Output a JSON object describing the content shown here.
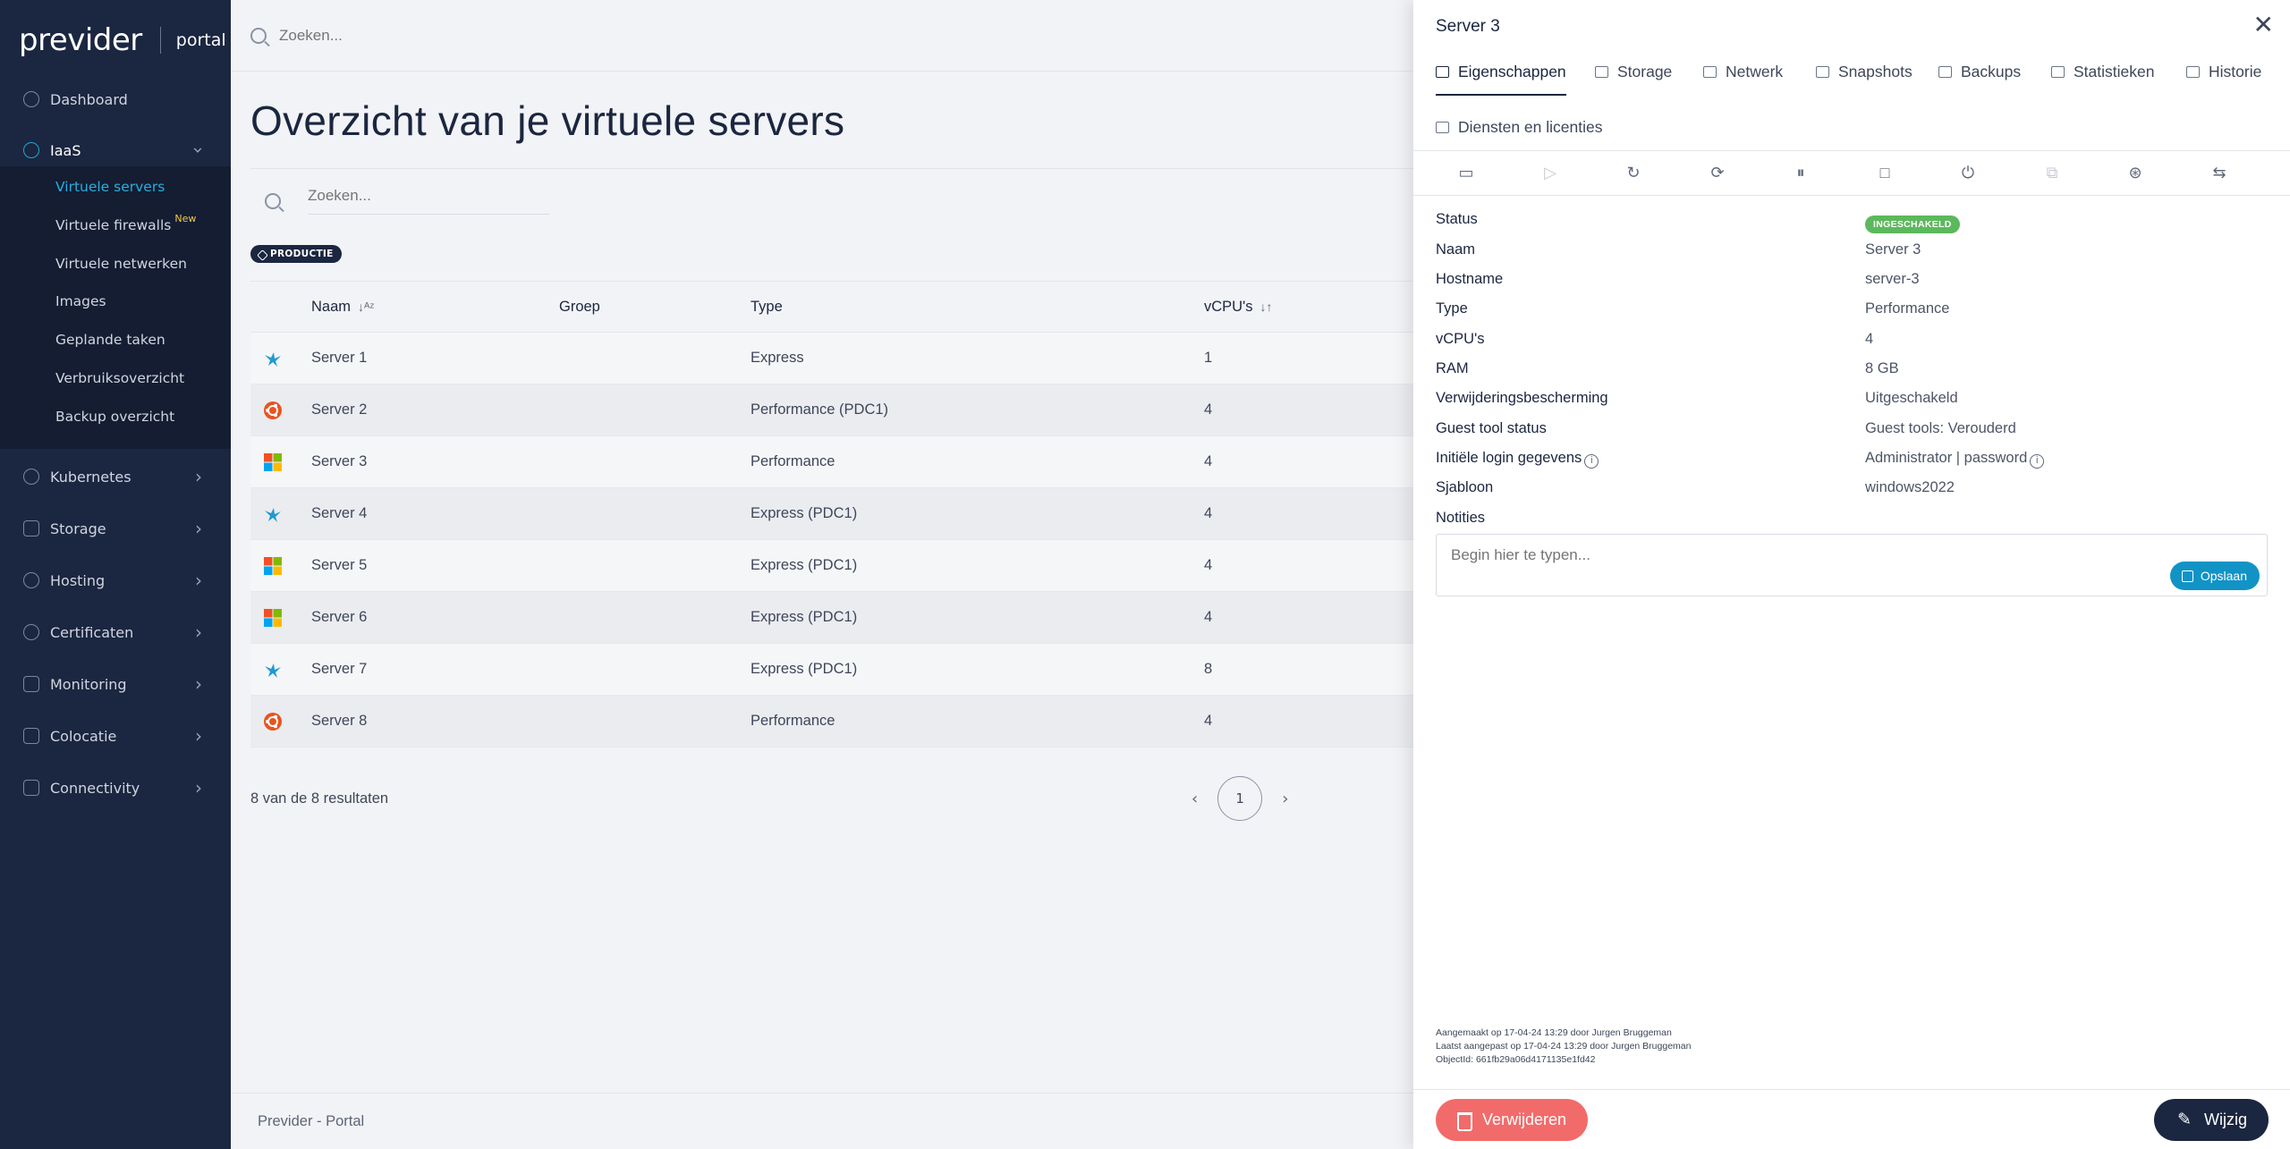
{
  "brand": {
    "logo": "previder",
    "product": "portal"
  },
  "sidebar": {
    "top": {
      "label": "Dashboard",
      "icon": "dashboard-icon"
    },
    "iaas": {
      "label": "IaaS",
      "icon": "cloud-icon"
    },
    "iaas_items": [
      {
        "label": "Virtuele servers"
      },
      {
        "label": "Virtuele firewalls",
        "badge": "New"
      },
      {
        "label": "Virtuele netwerken"
      },
      {
        "label": "Images"
      },
      {
        "label": "Geplande taken"
      },
      {
        "label": "Verbruiksoverzicht"
      },
      {
        "label": "Backup overzicht"
      }
    ],
    "groups": [
      {
        "label": "Kubernetes",
        "icon": "kubernetes-icon"
      },
      {
        "label": "Storage",
        "icon": "storage-icon"
      },
      {
        "label": "Hosting",
        "icon": "hosting-icon"
      },
      {
        "label": "Certificaten",
        "icon": "certificate-icon"
      },
      {
        "label": "Monitoring",
        "icon": "monitoring-icon"
      },
      {
        "label": "Colocatie",
        "icon": "colocation-icon"
      },
      {
        "label": "Connectivity",
        "icon": "connectivity-icon"
      }
    ]
  },
  "topbar": {
    "search_placeholder": "Zoeken..."
  },
  "page": {
    "title": "Overzicht van je virtuele servers",
    "filter_placeholder": "Zoeken...",
    "tag": "PRODUCTIE",
    "results": "8 van de 8 resultaten",
    "current_page": "1",
    "footer": "Previder - Portal"
  },
  "table": {
    "columns": [
      "Naam",
      "Groep",
      "Type",
      "vCPU's"
    ],
    "rows": [
      {
        "os": "linux-bird-icon",
        "name": "Server 1",
        "group": "",
        "type": "Express",
        "vcpu": "1"
      },
      {
        "os": "ubuntu-icon",
        "name": "Server 2",
        "group": "",
        "type": "Performance (PDC1)",
        "vcpu": "4"
      },
      {
        "os": "windows-icon",
        "name": "Server 3",
        "group": "",
        "type": "Performance",
        "vcpu": "4"
      },
      {
        "os": "linux-bird-icon",
        "name": "Server 4",
        "group": "",
        "type": "Express (PDC1)",
        "vcpu": "4"
      },
      {
        "os": "windows-icon",
        "name": "Server 5",
        "group": "",
        "type": "Express (PDC1)",
        "vcpu": "4"
      },
      {
        "os": "windows-icon",
        "name": "Server 6",
        "group": "",
        "type": "Express (PDC1)",
        "vcpu": "4"
      },
      {
        "os": "linux-bird-icon",
        "name": "Server 7",
        "group": "",
        "type": "Express (PDC1)",
        "vcpu": "8"
      },
      {
        "os": "ubuntu-icon",
        "name": "Server 8",
        "group": "",
        "type": "Performance",
        "vcpu": "4"
      }
    ]
  },
  "panel": {
    "title": "Server 3",
    "tabs": [
      "Eigenschappen",
      "Storage",
      "Netwerk",
      "Snapshots",
      "Backups",
      "Statistieken",
      "Historie",
      "Diensten en licenties"
    ],
    "toolbar": [
      "console-icon",
      "play-icon",
      "restart-icon",
      "reset-icon",
      "pause-icon",
      "stop-icon",
      "power-icon",
      "clone-icon",
      "tools-icon",
      "migrate-icon"
    ],
    "properties": [
      {
        "label": "Status",
        "value": "INGESCHAKELD"
      },
      {
        "label": "Naam",
        "value": "Server 3"
      },
      {
        "label": "Hostname",
        "value": "server-3"
      },
      {
        "label": "Type",
        "value": "Performance"
      },
      {
        "label": "vCPU's",
        "value": "4"
      },
      {
        "label": "RAM",
        "value": "8 GB"
      },
      {
        "label": "Verwijderingsbescherming",
        "value": "Uitgeschakeld"
      },
      {
        "label": "Guest tool status",
        "value": "Guest tools: Verouderd"
      },
      {
        "label": "Initiële login gegevens",
        "value": "Administrator | password"
      },
      {
        "label": "Sjabloon",
        "value": "windows2022"
      },
      {
        "label": "Notities",
        "value": ""
      }
    ],
    "notes_placeholder": "Begin hier te typen...",
    "save_label": "Opslaan",
    "audit": [
      "Aangemaakt op 17-04-24 13:29 door Jurgen Bruggeman",
      "Laatst aangepast op 17-04-24 13:29 door Jurgen Bruggeman",
      "ObjectId: 661fb29a06d4171135e1fd42"
    ],
    "delete_label": "Verwijderen",
    "edit_label": "Wijzig"
  },
  "colors": {
    "sidebar": "#1b2640",
    "accent": "#28aee0",
    "status": "#5cb85c",
    "danger": "#f26b6b",
    "save": "#1193c6"
  }
}
